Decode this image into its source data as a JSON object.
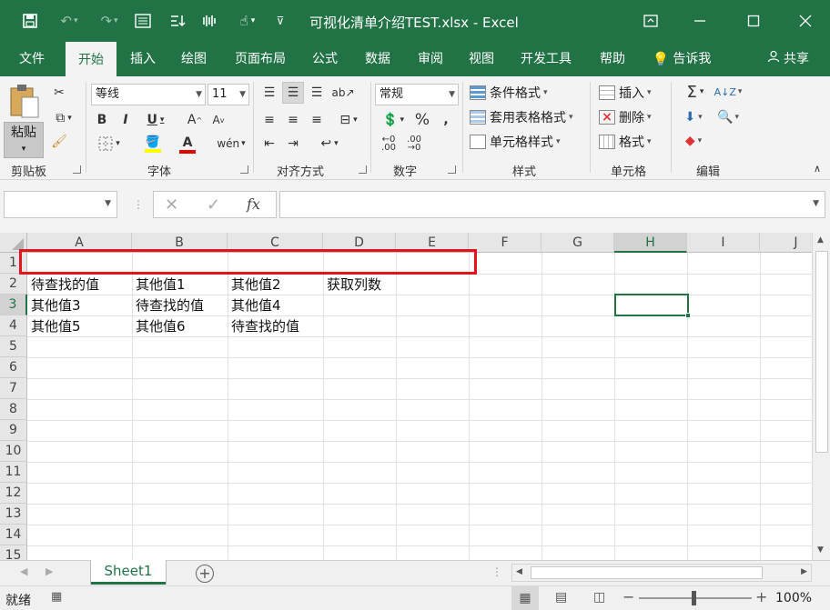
{
  "titlebar": {
    "title": "可视化清单介绍TEST.xlsx  -  Excel",
    "icons": [
      "save-icon",
      "undo-icon",
      "redo-icon",
      "form-icon",
      "sort-icon",
      "touch-mode-icon",
      "customize-qa-icon"
    ],
    "window_controls": [
      "ribbon-display-icon",
      "minimize-icon",
      "restore-icon",
      "close-icon"
    ]
  },
  "tabs": [
    {
      "label": "文件"
    },
    {
      "label": "开始"
    },
    {
      "label": "插入"
    },
    {
      "label": "绘图"
    },
    {
      "label": "页面布局"
    },
    {
      "label": "公式"
    },
    {
      "label": "数据"
    },
    {
      "label": "审阅"
    },
    {
      "label": "视图"
    },
    {
      "label": "开发工具"
    },
    {
      "label": "帮助"
    },
    {
      "label": "告诉我"
    }
  ],
  "share_label": "共享",
  "ribbon": {
    "clipboard": {
      "paste": "粘贴",
      "label": "剪贴板"
    },
    "font": {
      "name": "等线",
      "size": "11",
      "label": "字体"
    },
    "alignment": {
      "label": "对齐方式"
    },
    "number": {
      "format": "常规",
      "label": "数字"
    },
    "styles": {
      "conditional": "条件格式",
      "table": "套用表格格式",
      "cell": "单元格样式",
      "label": "样式"
    },
    "cells": {
      "insert": "插入",
      "delete": "删除",
      "format": "格式",
      "label": "单元格"
    },
    "editing": {
      "label": "编辑"
    }
  },
  "formula_bar": {
    "name_box": "",
    "formula": ""
  },
  "columns": [
    "A",
    "B",
    "C",
    "D",
    "E",
    "F",
    "G",
    "H",
    "I",
    "J"
  ],
  "selected_column": "H",
  "selected_row": "3",
  "rows": [
    "1",
    "2",
    "3",
    "4",
    "5",
    "6",
    "7",
    "8",
    "9",
    "10",
    "11",
    "12",
    "13",
    "14",
    "15"
  ],
  "cells": {
    "A2": "待查找的值",
    "B2": "其他值1",
    "C2": "其他值2",
    "D2": "获取列数",
    "A3": "其他值3",
    "B3": "待查找的值",
    "C3": "其他值4",
    "A4": "其他值5",
    "B4": "其他值6",
    "C4": "待查找的值"
  },
  "sheets": [
    {
      "name": "Sheet1"
    }
  ],
  "status": {
    "ready": "就绪",
    "zoom": "100%"
  },
  "colors": {
    "accent": "#217346",
    "highlight_box": "#e4141c"
  }
}
